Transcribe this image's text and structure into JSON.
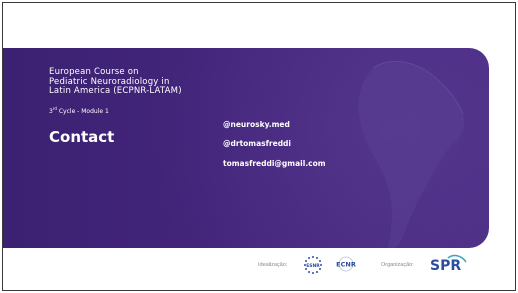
{
  "course": {
    "title_line1": "European Course on",
    "title_line2": "Pediatric Neuroradiology in",
    "title_line3": "Latin America (ECPNR-LATAM)",
    "cycle_num": "3",
    "cycle_sup": "rd",
    "cycle_rest": " Cycle - Module 1"
  },
  "heading": "Contact",
  "contacts": [
    "@neurosky.med",
    "@drtomasfreddi",
    "tomasfreddi@gmail.com"
  ],
  "footer": {
    "idealization_label": "Idealização:",
    "organization_label": "Organização:",
    "logos": [
      "ESNR",
      "ECNR",
      "SPR"
    ]
  },
  "colors": {
    "banner": "#3c2172",
    "text": "#ffffff",
    "footer_text": "#8a8a8a",
    "logo_blue": "#2b4ea0",
    "logo_teal": "#3aa6b9"
  }
}
